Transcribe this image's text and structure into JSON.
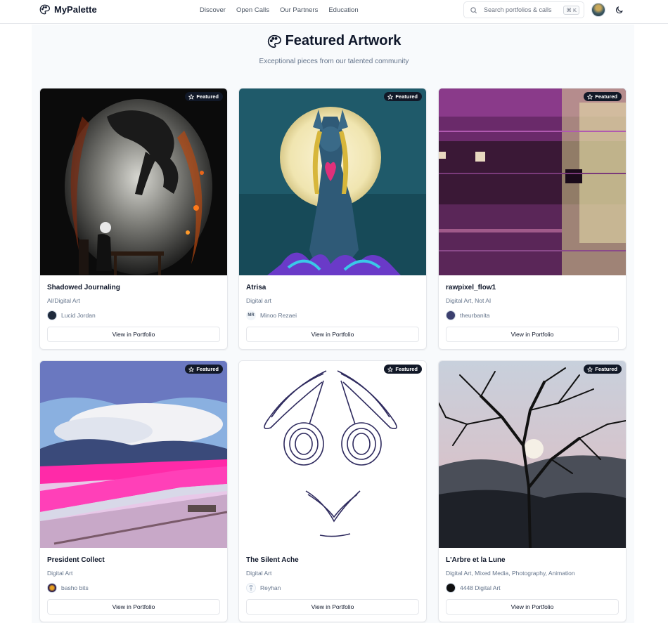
{
  "header": {
    "brand": "MyPalette",
    "nav": [
      "Discover",
      "Open Calls",
      "Our Partners",
      "Education"
    ],
    "search_placeholder": "Search portfolios & calls",
    "search_shortcut": "⌘ K"
  },
  "hero": {
    "title": "Featured Artwork",
    "subtitle": "Exceptional pieces from our talented community"
  },
  "badge_label": "Featured",
  "button_label": "View in Portfolio",
  "cards": [
    {
      "title": "Shadowed Journaling",
      "category": "AI/Digital Art",
      "artist": "Lucid Jordan",
      "artist_initials": ""
    },
    {
      "title": "Atrisa",
      "category": "Digital art",
      "artist": "Minoo Rezaei",
      "artist_initials": "MR"
    },
    {
      "title": "rawpixel_flow1",
      "category": "Digital Art, Not AI",
      "artist": "theurbanita",
      "artist_initials": ""
    },
    {
      "title": "President Collect",
      "category": "Digital Art",
      "artist": "basho bits",
      "artist_initials": ""
    },
    {
      "title": "The Silent Ache",
      "category": "Digital Art",
      "artist": "Reyhan",
      "artist_initials": ""
    },
    {
      "title": "L'Arbre et la Lune",
      "category": "Digital Art, Mixed Media, Photography, Animation",
      "artist": "4448 Digital Art",
      "artist_initials": ""
    }
  ],
  "colors": {
    "text_primary": "#0f172a",
    "text_muted": "#64748b",
    "badge_bg": "#111827",
    "border": "#e5e7eb"
  }
}
